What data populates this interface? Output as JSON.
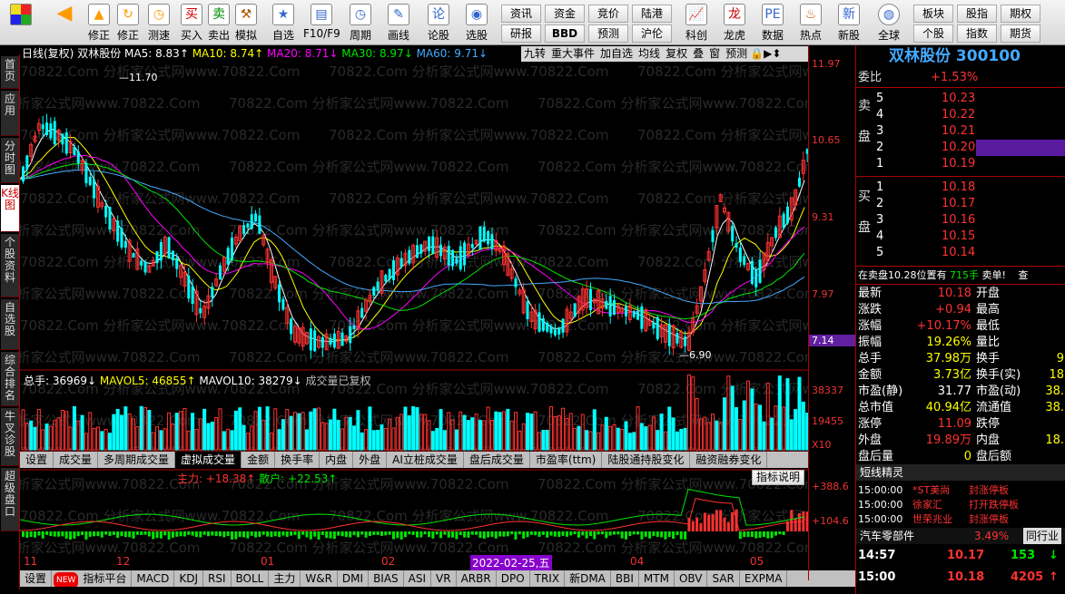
{
  "toolbar": {
    "tools": [
      {
        "icon": "buy-icon",
        "label": "买入"
      },
      {
        "icon": "sell-icon",
        "label": "卖出"
      },
      {
        "icon": "hammer-icon",
        "label": "模拟"
      },
      {
        "icon": "star-icon",
        "label": "自选"
      },
      {
        "icon": "f10-icon",
        "label": "F10/F9"
      },
      {
        "icon": "clock-icon",
        "label": "周期"
      },
      {
        "icon": "pencil-icon",
        "label": "画线"
      },
      {
        "icon": "stock-icon",
        "label": "论股"
      },
      {
        "icon": "select-icon",
        "label": "选股"
      }
    ],
    "nav_left": [
      {
        "icon": "back-arrow-icon",
        "label": ""
      },
      {
        "icon": "up-arrow-icon",
        "label": "修正"
      },
      {
        "icon": "refresh-icon",
        "label": "测速"
      }
    ],
    "btns": [
      [
        "资讯",
        "资金",
        "竞价",
        "陆港"
      ],
      [
        "研报",
        "BBD",
        "预测",
        "沪伦"
      ]
    ],
    "tools2": [
      {
        "label": "科创"
      },
      {
        "label": "龙虎"
      },
      {
        "label": "数据"
      },
      {
        "label": "热点"
      },
      {
        "label": "新股"
      }
    ],
    "right_btns": [
      [
        "板块",
        "股指",
        "期权"
      ],
      [
        "个股",
        "指数",
        "期货"
      ]
    ],
    "globe": "全球"
  },
  "left_tabs": [
    "首页",
    "应用",
    "分时图",
    "K线图",
    "个股资料",
    "自选股",
    "综合排名",
    "牛叉诊股",
    "超级盘口"
  ],
  "header": {
    "title": "日线(复权)",
    "stock": "双林股份",
    "ma5": "MA5: 8.83↑",
    "ma10": "MA10: 8.74↑",
    "ma20": "MA20: 8.71↓",
    "ma30": "MA30: 8.97↓",
    "ma60": "MA60: 9.71↓",
    "tools": [
      "九转",
      "重大事件",
      "加自选",
      "均线",
      "复权",
      "叠",
      "窗",
      "预测"
    ]
  },
  "price_axis": [
    "11.97",
    "10.65",
    "9.31",
    "7.97",
    "7.14"
  ],
  "hi_label": "11.70",
  "lo_label": "6.90",
  "vol_header": {
    "total": "总手: 36969↓",
    "mavol5": "MAVOL5: 46855↑",
    "mavol10": "MAVOL10: 38279↓",
    "note": "成交量已复权"
  },
  "vol_axis": [
    "38337",
    "19455",
    "X10"
  ],
  "tabs": [
    "设置",
    "成交量",
    "多周期成交量",
    "虚拟成交量",
    "金额",
    "换手率",
    "内盘",
    "外盘",
    "AI立桩成交量",
    "盘后成交量",
    "市盈率(ttm)",
    "陆股通持股变化",
    "融资融券变化"
  ],
  "tab_active": 3,
  "ind_header": {
    "main": "主力: +18.38↑",
    "retail": "散户: +22.53↑",
    "explain": "指标说明"
  },
  "ind_axis": [
    "+388.6",
    "+104.6"
  ],
  "dates": [
    "11",
    "12",
    "01",
    "02",
    "2022-02-25,五",
    "04",
    "05"
  ],
  "bottom_tabs": [
    "设置",
    "指标平台",
    "MACD",
    "KDJ",
    "RSI",
    "BOLL",
    "主力",
    "W&R",
    "DMI",
    "BIAS",
    "ASI",
    "VR",
    "ARBR",
    "DPO",
    "TRIX",
    "新DMA",
    "BBI",
    "MTM",
    "OBV",
    "SAR",
    "EXPMA"
  ],
  "new_badge": "NEW",
  "watermark": "70822.Com 分析家公式网www.70822.Com",
  "right": {
    "name": "双林股份",
    "code": "300100",
    "weibi_label": "委比",
    "weibi": "+1.53%",
    "sell_label": "卖盘",
    "buy_label": "买盘",
    "asks": [
      [
        "5",
        "10.23",
        ""
      ],
      [
        "4",
        "10.22",
        ""
      ],
      [
        "3",
        "10.21",
        ""
      ],
      [
        "2",
        "10.20",
        ""
      ],
      [
        "1",
        "10.19",
        ""
      ]
    ],
    "bids": [
      [
        "1",
        "10.18",
        ""
      ],
      [
        "2",
        "10.17",
        ""
      ],
      [
        "3",
        "10.16",
        ""
      ],
      [
        "4",
        "10.15",
        ""
      ],
      [
        "5",
        "10.14",
        ""
      ]
    ],
    "info": "在卖盘10.28位置有",
    "info_vol": "715手",
    "info_tag": "卖单!",
    "info_check": "查",
    "stats": [
      [
        "最新",
        "10.18",
        "开盘",
        ""
      ],
      [
        "涨跌",
        "+0.94",
        "最高",
        ""
      ],
      [
        "涨幅",
        "+10.17%",
        "最低",
        ""
      ],
      [
        "振幅",
        "19.26%",
        "量比",
        ""
      ],
      [
        "总手",
        "37.98万",
        "换手",
        "9"
      ],
      [
        "金额",
        "3.73亿",
        "换手(实)",
        "18"
      ],
      [
        "市盈(静)",
        "31.77",
        "市盈(动)",
        "38."
      ],
      [
        "总市值",
        "40.94亿",
        "流通值",
        "38."
      ],
      [
        "涨停",
        "11.09",
        "跌停",
        ""
      ],
      [
        "外盘",
        "19.89万",
        "内盘",
        "18."
      ],
      [
        "盘后量",
        "0",
        "盘后额",
        ""
      ]
    ],
    "spirit_title": "短线精灵",
    "spirit": [
      [
        "15:00:00",
        "*ST美尚",
        "封涨停板"
      ],
      [
        "15:00:00",
        "徐家汇",
        "打开跌停板"
      ],
      [
        "15:00:00",
        "世荣兆业",
        "封涨停板"
      ]
    ],
    "sector": "汽车零部件",
    "sector_pct": "3.49%",
    "sector_tab": "同行业",
    "ticks": [
      [
        "14:57",
        "10.17",
        "153"
      ],
      [
        "15:00",
        "10.18",
        "4205"
      ]
    ]
  }
}
